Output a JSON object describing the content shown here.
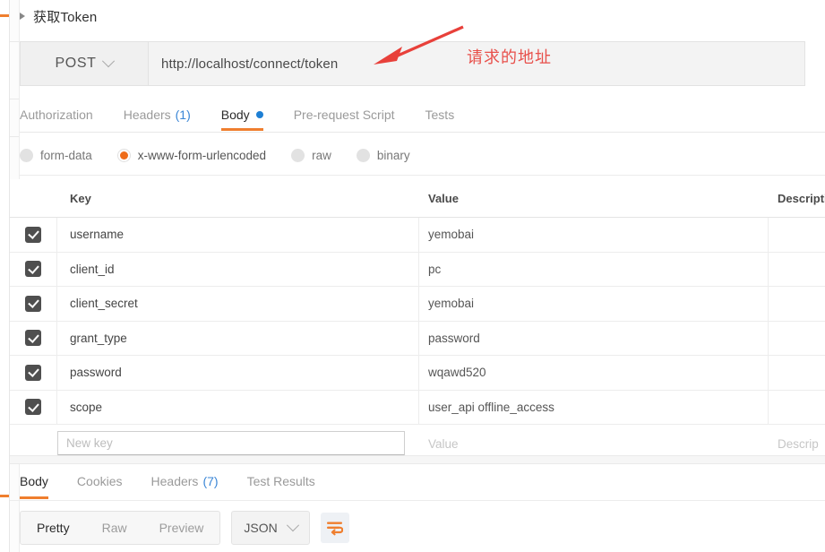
{
  "request": {
    "title": "获取Token",
    "collapse_icon": "triangle-right-icon",
    "method": "POST",
    "method_chevron": "chevron-down-icon",
    "url": "http://localhost/connect/token"
  },
  "annotation": {
    "text": "请求的地址",
    "color": "#e8504b",
    "arrow_icon": "arrow-pointing-left-icon"
  },
  "request_tabs": [
    {
      "label": "Authorization",
      "count": "",
      "active": false,
      "dot": false
    },
    {
      "label": "Headers",
      "count": "(1)",
      "active": false,
      "dot": false
    },
    {
      "label": "Body",
      "count": "",
      "active": true,
      "dot": true
    },
    {
      "label": "Pre-request Script",
      "count": "",
      "active": false,
      "dot": false
    },
    {
      "label": "Tests",
      "count": "",
      "active": false,
      "dot": false
    }
  ],
  "body_types": [
    {
      "label": "form-data",
      "checked": false
    },
    {
      "label": "x-www-form-urlencoded",
      "checked": true
    },
    {
      "label": "raw",
      "checked": false
    },
    {
      "label": "binary",
      "checked": false
    }
  ],
  "params_table": {
    "headers": {
      "key": "Key",
      "value": "Value",
      "description": "Descripti"
    },
    "rows": [
      {
        "checked": true,
        "key": "username",
        "value": "yemobai",
        "description": ""
      },
      {
        "checked": true,
        "key": "client_id",
        "value": "pc",
        "description": ""
      },
      {
        "checked": true,
        "key": "client_secret",
        "value": "yemobai",
        "description": ""
      },
      {
        "checked": true,
        "key": "grant_type",
        "value": "password",
        "description": ""
      },
      {
        "checked": true,
        "key": "password",
        "value": "wqawd520",
        "description": ""
      },
      {
        "checked": true,
        "key": "scope",
        "value": "user_api  offline_access",
        "description": ""
      }
    ],
    "new_row": {
      "key_placeholder": "New key",
      "value_placeholder": "Value",
      "description_placeholder": "Descrip"
    }
  },
  "response_tabs": [
    {
      "label": "Body",
      "count": "",
      "active": true
    },
    {
      "label": "Cookies",
      "count": "",
      "active": false
    },
    {
      "label": "Headers",
      "count": "(7)",
      "active": false
    },
    {
      "label": "Test Results",
      "count": "",
      "active": false
    }
  ],
  "response_toolbar": {
    "view_modes": [
      {
        "label": "Pretty",
        "active": true
      },
      {
        "label": "Raw",
        "active": false
      },
      {
        "label": "Preview",
        "active": false
      }
    ],
    "format": "JSON",
    "format_chevron": "chevron-down-icon",
    "wrap_icon": "word-wrap-icon"
  },
  "colors": {
    "accent_orange": "#ef7e2e",
    "link_blue": "#3a86d6",
    "dot_blue": "#1e7fd4",
    "annotation_red": "#e8504b",
    "checkbox_dark": "#4f4f4f"
  }
}
